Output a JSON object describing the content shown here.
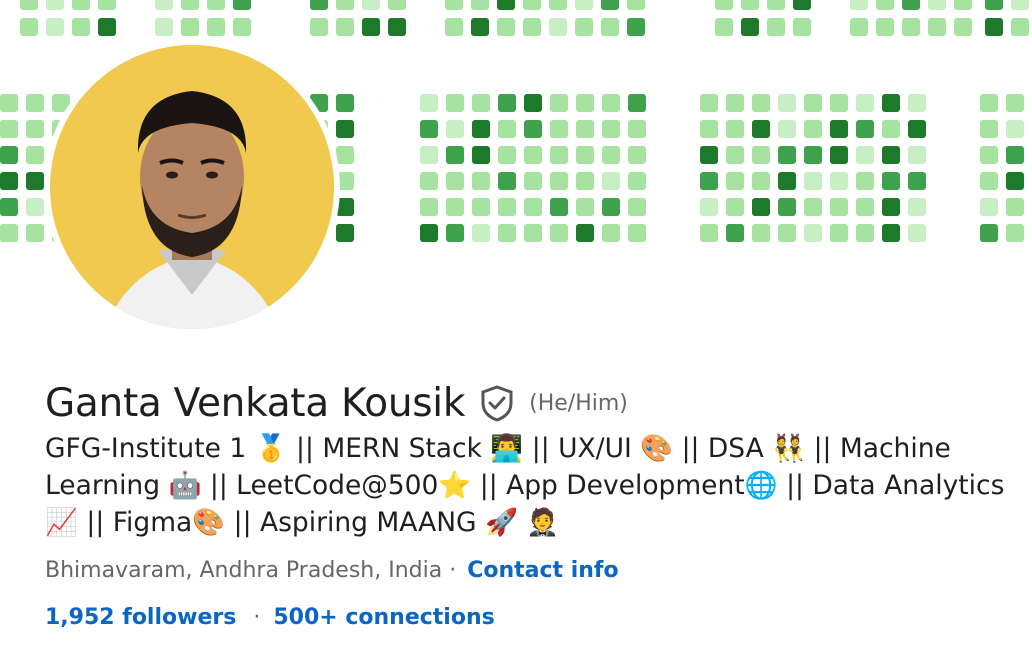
{
  "profile": {
    "name": "Ganta Venkata Kousik",
    "pronouns": "(He/Him)",
    "headline": "GFG-Institute 1 🥇 || MERN Stack 👨‍💻 || UX/UI 🎨 || DSA 👯 || Machine Learning 🤖 || LeetCode@500⭐ || App Development🌐 || Data Analytics 📈 || Figma🎨 || Aspiring MAANG 🚀 🤵",
    "location": "Bhimavaram, Andhra Pradesh, India",
    "separator": "·",
    "contact_label": "Contact info",
    "followers_label": "1,952 followers",
    "connections_label": "500+ connections"
  },
  "icons": {
    "verified": "verified-shield-icon",
    "avatar": "profile-photo"
  },
  "colors": {
    "text_primary": "#1f1f1f",
    "text_secondary": "#666666",
    "link": "#0a66c2",
    "avatar_bg": "#f0c94e",
    "grid_light": "#a6e3a1",
    "grid_mid": "#3fa34d",
    "grid_dark": "#1e7a2b"
  }
}
